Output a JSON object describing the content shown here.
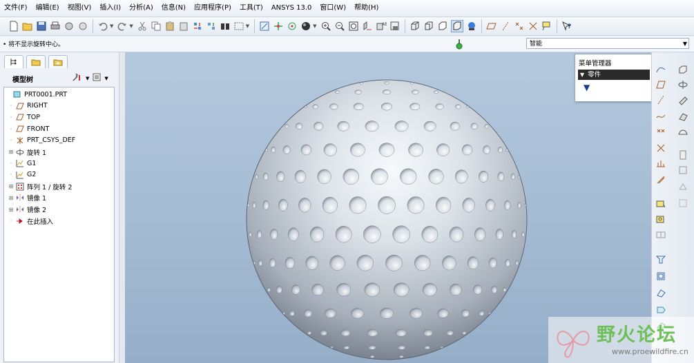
{
  "menubar": {
    "items": [
      "文件(F)",
      "编辑(E)",
      "视图(V)",
      "插入(I)",
      "分析(A)",
      "信息(N)",
      "应用程序(P)",
      "工具(T)",
      "ANSYS 13.0",
      "窗口(W)",
      "帮助(H)"
    ]
  },
  "status": {
    "message": "• 将不显示旋转中心。"
  },
  "filter": {
    "value": "智能"
  },
  "model_tree": {
    "title": "模型树",
    "items": [
      {
        "label": "PRT0001.PRT",
        "icon": "part-icon",
        "indent": 0,
        "expandable": false
      },
      {
        "label": "RIGHT",
        "icon": "datum-plane-icon",
        "indent": 1,
        "expandable": false
      },
      {
        "label": "TOP",
        "icon": "datum-plane-icon",
        "indent": 1,
        "expandable": false
      },
      {
        "label": "FRONT",
        "icon": "datum-plane-icon",
        "indent": 1,
        "expandable": false
      },
      {
        "label": "PRT_CSYS_DEF",
        "icon": "csys-icon",
        "indent": 1,
        "expandable": false
      },
      {
        "label": "旋转 1",
        "icon": "revolve-icon",
        "indent": 1,
        "expandable": true
      },
      {
        "label": "G1",
        "icon": "graph-icon",
        "indent": 1,
        "expandable": false
      },
      {
        "label": "G2",
        "icon": "graph-icon",
        "indent": 1,
        "expandable": false
      },
      {
        "label": "阵列 1 / 旋转 2",
        "icon": "pattern-icon",
        "indent": 1,
        "expandable": true
      },
      {
        "label": "镜像 1",
        "icon": "mirror-icon",
        "indent": 1,
        "expandable": true
      },
      {
        "label": "镜像 2",
        "icon": "mirror-icon",
        "indent": 1,
        "expandable": true
      },
      {
        "label": "在此插入",
        "icon": "insert-here-icon",
        "indent": 1,
        "expandable": false
      }
    ]
  },
  "menu_manager": {
    "title": "菜单管理器",
    "section": "零件"
  },
  "watermark": {
    "text": "野火论坛",
    "url": "www.proewildfire.cn"
  }
}
